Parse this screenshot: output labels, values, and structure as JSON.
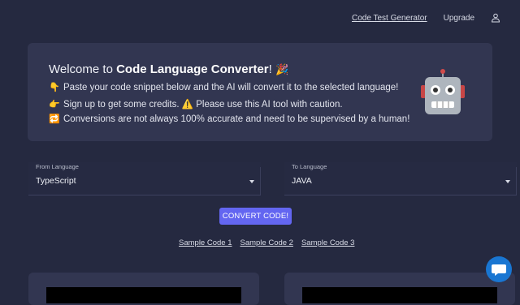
{
  "nav": {
    "code_test_generator": "Code Test Generator",
    "upgrade": "Upgrade",
    "user_icon": "user-icon"
  },
  "welcome": {
    "title_prefix": "Welcome to ",
    "title_bold": "Code Language Converter",
    "title_suffix": "! ",
    "party_icon": "🎉",
    "lines": [
      {
        "icon": "👇",
        "text": "Paste your code snippet below and the AI will convert it to the selected language!"
      },
      {
        "icon": "👉",
        "text": "Sign up to get some credits. ⚠️ Please use this AI tool with caution."
      },
      {
        "icon": "🔁",
        "text": "Conversions are not always 100% accurate and need to be supervised by a human!"
      }
    ],
    "robot_icon": "robot-icon"
  },
  "from": {
    "label": "From Language",
    "value": "TypeScript"
  },
  "to": {
    "label": "To Language",
    "value": "JAVA"
  },
  "convert_label": "CONVERT CODE!",
  "samples": [
    "Sample Code 1",
    "Sample Code 2",
    "Sample Code 3"
  ],
  "colors": {
    "background": "#252940",
    "card": "#323651",
    "accent": "#6366f1",
    "chat": "#1976d2"
  }
}
